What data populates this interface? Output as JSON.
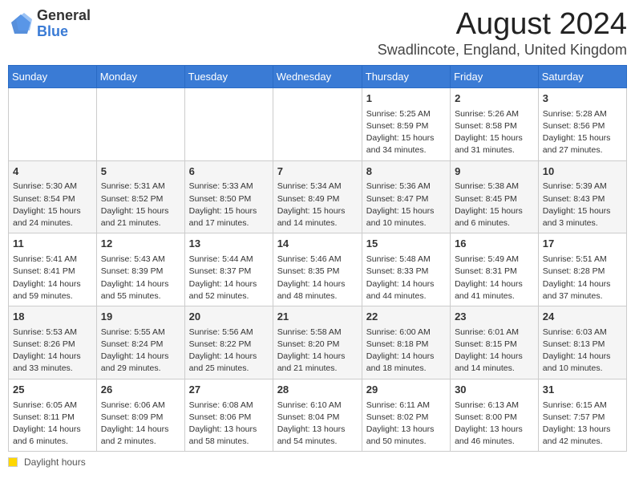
{
  "header": {
    "logo_general": "General",
    "logo_blue": "Blue",
    "main_title": "August 2024",
    "subtitle": "Swadlincote, England, United Kingdom"
  },
  "calendar": {
    "days_of_week": [
      "Sunday",
      "Monday",
      "Tuesday",
      "Wednesday",
      "Thursday",
      "Friday",
      "Saturday"
    ],
    "weeks": [
      [
        {
          "day": "",
          "info": ""
        },
        {
          "day": "",
          "info": ""
        },
        {
          "day": "",
          "info": ""
        },
        {
          "day": "",
          "info": ""
        },
        {
          "day": "1",
          "info": "Sunrise: 5:25 AM\nSunset: 8:59 PM\nDaylight: 15 hours\nand 34 minutes."
        },
        {
          "day": "2",
          "info": "Sunrise: 5:26 AM\nSunset: 8:58 PM\nDaylight: 15 hours\nand 31 minutes."
        },
        {
          "day": "3",
          "info": "Sunrise: 5:28 AM\nSunset: 8:56 PM\nDaylight: 15 hours\nand 27 minutes."
        }
      ],
      [
        {
          "day": "4",
          "info": "Sunrise: 5:30 AM\nSunset: 8:54 PM\nDaylight: 15 hours\nand 24 minutes."
        },
        {
          "day": "5",
          "info": "Sunrise: 5:31 AM\nSunset: 8:52 PM\nDaylight: 15 hours\nand 21 minutes."
        },
        {
          "day": "6",
          "info": "Sunrise: 5:33 AM\nSunset: 8:50 PM\nDaylight: 15 hours\nand 17 minutes."
        },
        {
          "day": "7",
          "info": "Sunrise: 5:34 AM\nSunset: 8:49 PM\nDaylight: 15 hours\nand 14 minutes."
        },
        {
          "day": "8",
          "info": "Sunrise: 5:36 AM\nSunset: 8:47 PM\nDaylight: 15 hours\nand 10 minutes."
        },
        {
          "day": "9",
          "info": "Sunrise: 5:38 AM\nSunset: 8:45 PM\nDaylight: 15 hours\nand 6 minutes."
        },
        {
          "day": "10",
          "info": "Sunrise: 5:39 AM\nSunset: 8:43 PM\nDaylight: 15 hours\nand 3 minutes."
        }
      ],
      [
        {
          "day": "11",
          "info": "Sunrise: 5:41 AM\nSunset: 8:41 PM\nDaylight: 14 hours\nand 59 minutes."
        },
        {
          "day": "12",
          "info": "Sunrise: 5:43 AM\nSunset: 8:39 PM\nDaylight: 14 hours\nand 55 minutes."
        },
        {
          "day": "13",
          "info": "Sunrise: 5:44 AM\nSunset: 8:37 PM\nDaylight: 14 hours\nand 52 minutes."
        },
        {
          "day": "14",
          "info": "Sunrise: 5:46 AM\nSunset: 8:35 PM\nDaylight: 14 hours\nand 48 minutes."
        },
        {
          "day": "15",
          "info": "Sunrise: 5:48 AM\nSunset: 8:33 PM\nDaylight: 14 hours\nand 44 minutes."
        },
        {
          "day": "16",
          "info": "Sunrise: 5:49 AM\nSunset: 8:31 PM\nDaylight: 14 hours\nand 41 minutes."
        },
        {
          "day": "17",
          "info": "Sunrise: 5:51 AM\nSunset: 8:28 PM\nDaylight: 14 hours\nand 37 minutes."
        }
      ],
      [
        {
          "day": "18",
          "info": "Sunrise: 5:53 AM\nSunset: 8:26 PM\nDaylight: 14 hours\nand 33 minutes."
        },
        {
          "day": "19",
          "info": "Sunrise: 5:55 AM\nSunset: 8:24 PM\nDaylight: 14 hours\nand 29 minutes."
        },
        {
          "day": "20",
          "info": "Sunrise: 5:56 AM\nSunset: 8:22 PM\nDaylight: 14 hours\nand 25 minutes."
        },
        {
          "day": "21",
          "info": "Sunrise: 5:58 AM\nSunset: 8:20 PM\nDaylight: 14 hours\nand 21 minutes."
        },
        {
          "day": "22",
          "info": "Sunrise: 6:00 AM\nSunset: 8:18 PM\nDaylight: 14 hours\nand 18 minutes."
        },
        {
          "day": "23",
          "info": "Sunrise: 6:01 AM\nSunset: 8:15 PM\nDaylight: 14 hours\nand 14 minutes."
        },
        {
          "day": "24",
          "info": "Sunrise: 6:03 AM\nSunset: 8:13 PM\nDaylight: 14 hours\nand 10 minutes."
        }
      ],
      [
        {
          "day": "25",
          "info": "Sunrise: 6:05 AM\nSunset: 8:11 PM\nDaylight: 14 hours\nand 6 minutes."
        },
        {
          "day": "26",
          "info": "Sunrise: 6:06 AM\nSunset: 8:09 PM\nDaylight: 14 hours\nand 2 minutes."
        },
        {
          "day": "27",
          "info": "Sunrise: 6:08 AM\nSunset: 8:06 PM\nDaylight: 13 hours\nand 58 minutes."
        },
        {
          "day": "28",
          "info": "Sunrise: 6:10 AM\nSunset: 8:04 PM\nDaylight: 13 hours\nand 54 minutes."
        },
        {
          "day": "29",
          "info": "Sunrise: 6:11 AM\nSunset: 8:02 PM\nDaylight: 13 hours\nand 50 minutes."
        },
        {
          "day": "30",
          "info": "Sunrise: 6:13 AM\nSunset: 8:00 PM\nDaylight: 13 hours\nand 46 minutes."
        },
        {
          "day": "31",
          "info": "Sunrise: 6:15 AM\nSunset: 7:57 PM\nDaylight: 13 hours\nand 42 minutes."
        }
      ]
    ]
  },
  "footer": {
    "daylight_label": "Daylight hours"
  }
}
